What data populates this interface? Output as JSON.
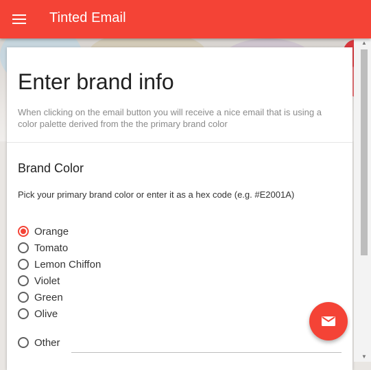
{
  "app_bar": {
    "title": "Tinted Email",
    "menu_icon": "menu-icon",
    "color": "#f44336"
  },
  "card": {
    "title": "Enter brand info",
    "description": "When clicking on the email button you will receive a nice email that is using a color palette derived from the the primary brand color"
  },
  "brand_color": {
    "heading": "Brand Color",
    "hint": "Pick your primary brand color or enter it as a hex code (e.g. #E2001A)",
    "options": [
      {
        "label": "Orange",
        "checked": true
      },
      {
        "label": "Tomato",
        "checked": false
      },
      {
        "label": "Lemon Chiffon",
        "checked": false
      },
      {
        "label": "Violet",
        "checked": false
      },
      {
        "label": "Green",
        "checked": false
      },
      {
        "label": "Olive",
        "checked": false
      }
    ],
    "other_label": "Other",
    "other_value": ""
  },
  "fab": {
    "icon": "mail-icon",
    "color": "#f44336"
  },
  "colors": {
    "accent": "#f44336",
    "text": "#212121",
    "secondary_text": "#8a8a8a"
  }
}
